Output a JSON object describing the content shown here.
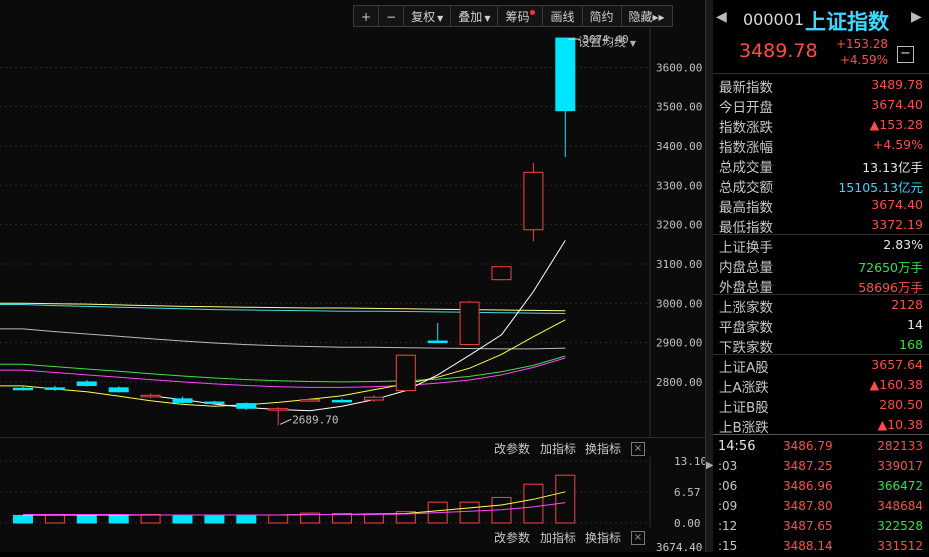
{
  "toolbar": {
    "plus": "+",
    "minus": "−",
    "fuquan": "复权",
    "diejia": "叠加",
    "chouma": "筹码",
    "huaxian": "画线",
    "jianyue": "简约",
    "yincang": "隐藏",
    "more": "▸▸"
  },
  "chart": {
    "ma_setting": "设置均线",
    "high_label": "3674.40",
    "low_label": "2689.70",
    "yticks": [
      "3600.00",
      "3500.00",
      "3400.00",
      "3300.00",
      "3200.00",
      "3100.00",
      "3000.00",
      "2900.00",
      "2800.00"
    ],
    "sub_ticks": [
      "13.10",
      "6.57",
      "0.00"
    ],
    "sub_tools": {
      "params": "改参数",
      "add": "加指标",
      "switch": "换指标",
      "close": "×"
    },
    "bottom_label": "3674.40",
    "colors": {
      "up": "#ff4040",
      "down": "#00e5ff",
      "ma5": "#ffffff",
      "ma10": "#ffff44",
      "ma20": "#ff44ff",
      "ma30": "#44dd44",
      "ma60": "#bbbbbb",
      "ma120": "#44dddd",
      "ma250": "#ffff88"
    }
  },
  "chart_data": {
    "type": "candlestick",
    "candles": [
      {
        "o": 2784,
        "c": 2781,
        "h": 2788,
        "l": 2778
      },
      {
        "o": 2785,
        "c": 2781,
        "h": 2790,
        "l": 2777
      },
      {
        "o": 2800,
        "c": 2791,
        "h": 2805,
        "l": 2788
      },
      {
        "o": 2785,
        "c": 2775,
        "h": 2789,
        "l": 2773
      },
      {
        "o": 2762,
        "c": 2766,
        "h": 2771,
        "l": 2758
      },
      {
        "o": 2757,
        "c": 2748,
        "h": 2763,
        "l": 2742
      },
      {
        "o": 2749,
        "c": 2746,
        "h": 2752,
        "l": 2744
      },
      {
        "o": 2745,
        "c": 2733,
        "h": 2748,
        "l": 2729
      },
      {
        "o": 2730,
        "c": 2732,
        "h": 2736,
        "l": 2689.7
      },
      {
        "o": 2753,
        "c": 2755,
        "h": 2760,
        "l": 2750
      },
      {
        "o": 2753,
        "c": 2752,
        "h": 2758,
        "l": 2747
      },
      {
        "o": 2754,
        "c": 2761,
        "h": 2766,
        "l": 2749
      },
      {
        "o": 2778,
        "c": 2868,
        "h": 2870,
        "l": 2776
      },
      {
        "o": 2904,
        "c": 2900,
        "h": 2950,
        "l": 2899
      },
      {
        "o": 2895,
        "c": 3003,
        "h": 3006,
        "l": 2893
      },
      {
        "o": 3060,
        "c": 3093,
        "h": 3094,
        "l": 3058
      },
      {
        "o": 3187,
        "c": 3333,
        "h": 3357,
        "l": 3158
      },
      {
        "o": 3674.4,
        "c": 3489.78,
        "h": 3674.4,
        "l": 3372.19
      }
    ],
    "ma": {
      "ma5": [
        2765,
        2755,
        2744,
        2735,
        2730,
        2727,
        2738,
        2755,
        2778,
        2818,
        2868,
        2920,
        3030,
        3160
      ],
      "ma10": [
        2790,
        2782,
        2775,
        2764,
        2752,
        2743,
        2738,
        2742,
        2748,
        2756,
        2765,
        2780,
        2795,
        2812,
        2835,
        2870,
        2915,
        2958
      ],
      "ma20": [
        2830,
        2824,
        2818,
        2812,
        2806,
        2800,
        2795,
        2791,
        2788,
        2786,
        2786,
        2788,
        2791,
        2797,
        2805,
        2818,
        2837,
        2861
      ],
      "ma30": [
        2845,
        2839,
        2833,
        2827,
        2821,
        2815,
        2810,
        2806,
        2803,
        2801,
        2800,
        2801,
        2803,
        2807,
        2814,
        2826,
        2842,
        2866
      ],
      "ma60": [
        2935,
        2928,
        2922,
        2916,
        2910,
        2904,
        2899,
        2895,
        2892,
        2890,
        2888,
        2888,
        2887,
        2886,
        2885,
        2884,
        2884,
        2886
      ],
      "ma120": [
        2997,
        2994,
        2992,
        2990,
        2988,
        2986,
        2984,
        2983,
        2982,
        2981,
        2980,
        2980,
        2979,
        2978,
        2977,
        2976,
        2975,
        2974
      ],
      "ma250": [
        3000,
        2999,
        2998,
        2996,
        2994,
        2992,
        2991,
        2990,
        2989,
        2988,
        2988,
        2987,
        2986,
        2985,
        2984,
        2983,
        2982,
        2981
      ]
    },
    "volume": {
      "values": [
        1.6,
        1.7,
        1.6,
        1.7,
        1.8,
        1.6,
        1.6,
        1.7,
        1.7,
        2.1,
        2.0,
        1.9,
        2.4,
        4.4,
        4.4,
        5.4,
        8.2,
        10.1
      ],
      "up": [
        false,
        true,
        false,
        false,
        true,
        false,
        false,
        false,
        true,
        true,
        true,
        true,
        true,
        true,
        true,
        true,
        true,
        true
      ],
      "ma5": [
        1.7,
        1.7,
        1.7,
        1.7,
        1.7,
        1.7,
        1.7,
        1.7,
        1.7,
        1.8,
        1.8,
        1.9,
        2.0,
        2.6,
        3.2,
        3.8,
        5.0,
        6.6
      ],
      "ma10": [
        1.8,
        1.8,
        1.8,
        1.8,
        1.7,
        1.7,
        1.7,
        1.7,
        1.7,
        1.8,
        1.8,
        1.8,
        1.9,
        2.2,
        2.5,
        2.8,
        3.4,
        4.3
      ],
      "ylim": [
        0,
        13.1
      ]
    },
    "ylim": [
      2660,
      3700
    ]
  },
  "panel": {
    "code": "000001",
    "name": "上证指数",
    "price": "3489.78",
    "change": "+153.28",
    "change_pct": "+4.59%",
    "minus_btn": "−",
    "left_arrow": "◀",
    "right_arrow": "▶",
    "rows": [
      {
        "k": "最新指数",
        "v": "3489.78",
        "c": "red"
      },
      {
        "k": "今日开盘",
        "v": "3674.40",
        "c": "red"
      },
      {
        "k": "指数涨跌",
        "v": "▲153.28",
        "c": "red"
      },
      {
        "k": "指数涨幅",
        "v": "+4.59%",
        "c": "red"
      },
      {
        "k": "总成交量",
        "v": "13.13亿手",
        "c": "white"
      },
      {
        "k": "总成交额",
        "v": "15105.13亿元",
        "c": "cyan"
      },
      {
        "k": "最高指数",
        "v": "3674.40",
        "c": "red"
      },
      {
        "k": "最低指数",
        "v": "3372.19",
        "c": "red"
      },
      {
        "k": "上证换手",
        "v": "2.83%",
        "c": "white"
      },
      {
        "k": "内盘总量",
        "v": "72650万手",
        "c": "green"
      },
      {
        "k": "外盘总量",
        "v": "58696万手",
        "c": "red"
      },
      {
        "k": "上涨家数",
        "v": "2128",
        "c": "red"
      },
      {
        "k": "平盘家数",
        "v": "14",
        "c": "white"
      },
      {
        "k": "下跌家数",
        "v": "168",
        "c": "green"
      },
      {
        "k": "上证A股",
        "v": "3657.64",
        "c": "red"
      },
      {
        "k": "上A涨跌",
        "v": "▲160.38",
        "c": "red"
      },
      {
        "k": "上证B股",
        "v": "280.50",
        "c": "red"
      },
      {
        "k": "上B涨跌",
        "v": "▲10.38",
        "c": "red"
      }
    ],
    "ticks": [
      {
        "t": "14:56",
        "p": "3486.79",
        "v": "282133",
        "c": "red"
      },
      {
        "t": ":03",
        "p": "3487.25",
        "v": "339017",
        "c": "red"
      },
      {
        "t": ":06",
        "p": "3486.96",
        "v": "366472",
        "c": "green"
      },
      {
        "t": ":09",
        "p": "3487.80",
        "v": "348684",
        "c": "red"
      },
      {
        "t": ":12",
        "p": "3487.65",
        "v": "322528",
        "c": "green"
      },
      {
        "t": ":15",
        "p": "3488.14",
        "v": "331512",
        "c": "red"
      }
    ]
  }
}
